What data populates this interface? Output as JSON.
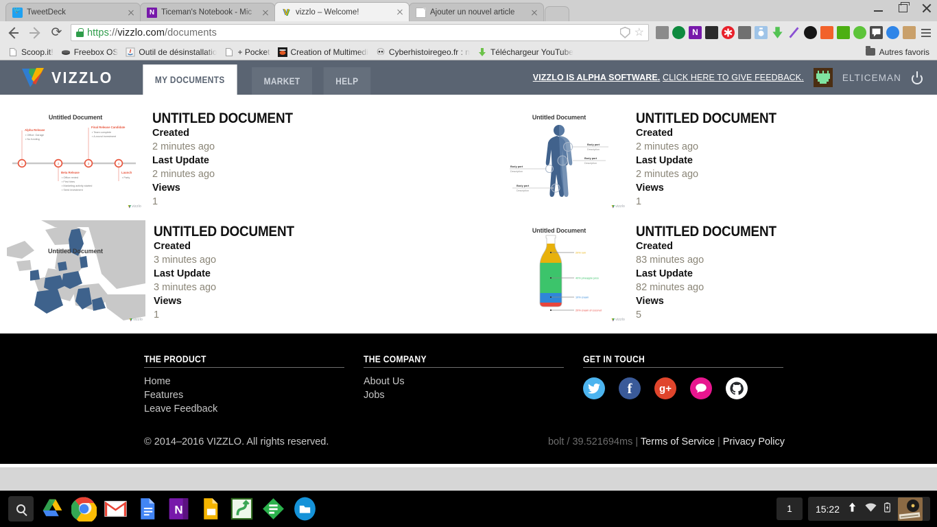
{
  "browser": {
    "tabs": [
      {
        "title": "TweetDeck",
        "favicon": "tweetdeck-icon",
        "active": false
      },
      {
        "title": "Ticeman's Notebook - Mic",
        "favicon": "onenote-icon",
        "active": false
      },
      {
        "title": "vizzlo – Welcome!",
        "favicon": "vizzlo-icon",
        "active": true
      },
      {
        "title": "Ajouter un nouvel article",
        "favicon": "page-icon",
        "active": false
      }
    ],
    "window_controls": [
      "minimize",
      "maximize",
      "close"
    ],
    "nav": {
      "back": "back-button",
      "forward": "forward-button",
      "reload": "reload-button"
    },
    "omnibox": {
      "scheme": "https",
      "separator": "://",
      "host": "vizzlo.com",
      "path": "/documents",
      "full_url": "https://vizzlo.com/documents",
      "secure_icon": "lock-icon",
      "shield_icon": "shield-icon",
      "bookmark_icon": "star-icon"
    },
    "extensions": [
      {
        "name": "extension-blocks",
        "color": "#8b8b8b"
      },
      {
        "name": "extension-green-download",
        "color": "#0e8a3e"
      },
      {
        "name": "extension-onenote",
        "color": "#7719aa"
      },
      {
        "name": "extension-film",
        "color": "#2b2b2b"
      },
      {
        "name": "extension-asterisk-red",
        "color": "#e8202a"
      },
      {
        "name": "extension-grey-app",
        "color": "#707070"
      },
      {
        "name": "extension-camera",
        "color": "#9fc4e8"
      },
      {
        "name": "extension-green-arrow",
        "color": "#53c353"
      },
      {
        "name": "extension-purple-feather",
        "color": "#8a4fd3"
      },
      {
        "name": "extension-dark-lens",
        "color": "#151515"
      },
      {
        "name": "extension-orange-book",
        "color": "#f2622a"
      },
      {
        "name": "extension-green-print",
        "color": "#4caf12"
      },
      {
        "name": "extension-green-dot",
        "color": "#5dc43a"
      },
      {
        "name": "extension-speech-bubble",
        "color": "#4a4a4a"
      },
      {
        "name": "extension-blue-fox",
        "color": "#2f85e8"
      },
      {
        "name": "extension-cat",
        "color": "#c9a06a"
      }
    ],
    "menu_icon": "chrome-menu-icon",
    "bookmarks": [
      {
        "label": "Scoop.it!",
        "icon": "page-icon"
      },
      {
        "label": "Freebox OS",
        "icon": "freebox-icon"
      },
      {
        "label": "Outil de désinstallatio",
        "icon": "java-icon"
      },
      {
        "label": "+ Pocket",
        "icon": "page-icon"
      },
      {
        "label": "Creation of Multimedi",
        "icon": "multimedia-icon"
      },
      {
        "label": "Cyberhistoiregeo.fr : n",
        "icon": "skull-icon"
      },
      {
        "label": "Téléchargeur YouTube",
        "icon": "green-download-icon"
      }
    ],
    "other_bookmarks": {
      "label": "Autres favoris",
      "icon": "folder-icon"
    }
  },
  "vizzlo": {
    "brand": "VIZZLO",
    "logo_icon": "vizzlo-v-logo",
    "nav": [
      {
        "label": "MY DOCUMENTS",
        "active": true
      },
      {
        "label": "MARKET",
        "active": false
      },
      {
        "label": "HELP",
        "active": false
      }
    ],
    "alpha_notice_bold": "VIZZLO IS ALPHA SOFTWARE.",
    "alpha_notice_link": "CLICK HERE TO GIVE FEEDBACK.",
    "user": {
      "name": "ELTICEMAN",
      "avatar_icon": "pixel-avatar-icon"
    },
    "logout_icon": "power-icon"
  },
  "documents": [
    {
      "title": "UNTITLED DOCUMENT",
      "thumb_title": "Untitled Document",
      "thumb_type": "timeline-chart",
      "labels": {
        "created": "Created",
        "last_update": "Last Update",
        "views": "Views"
      },
      "created": "2 minutes ago",
      "last_update": "2 minutes ago",
      "views": "1",
      "credit": "vizzlo"
    },
    {
      "title": "UNTITLED DOCUMENT",
      "thumb_title": "Untitled Document",
      "thumb_type": "body-diagram",
      "labels": {
        "created": "Created",
        "last_update": "Last Update",
        "views": "Views"
      },
      "created": "2 minutes ago",
      "last_update": "2 minutes ago",
      "views": "1",
      "credit": "vizzlo"
    },
    {
      "title": "UNTITLED DOCUMENT",
      "thumb_title": "Untitled Document",
      "thumb_type": "europe-map",
      "labels": {
        "created": "Created",
        "last_update": "Last Update",
        "views": "Views"
      },
      "created": "3 minutes ago",
      "last_update": "3 minutes ago",
      "views": "1",
      "credit": "vizzlo"
    },
    {
      "title": "UNTITLED DOCUMENT",
      "thumb_title": "Untitled Document",
      "thumb_type": "bottle-chart",
      "labels": {
        "created": "Created",
        "last_update": "Last Update",
        "views": "Views"
      },
      "created": "83 minutes ago",
      "last_update": "82 minutes ago",
      "views": "5",
      "credit": "vizzlo"
    }
  ],
  "thumb_content": {
    "timeline": {
      "milestones": [
        {
          "n": "1",
          "title": "Alpha Release",
          "items": [
            "Office: Garage",
            "No funding"
          ],
          "above": true
        },
        {
          "n": "2",
          "title": "Beta Release",
          "items": [
            "Office rented",
            "First hires",
            "Marketing activity started",
            "Seed investment"
          ],
          "above": false
        },
        {
          "n": "3",
          "title": "Final Release Candidate",
          "items": [
            "Team complete",
            "A-round investment"
          ],
          "above": true
        },
        {
          "n": "4",
          "title": "Launch",
          "items": [
            "Party"
          ],
          "above": false
        }
      ]
    },
    "body": {
      "callouts": [
        {
          "title": "Body part",
          "desc": "Description",
          "side": "right"
        },
        {
          "title": "Body part",
          "desc": "Description",
          "side": "right"
        },
        {
          "title": "Body part",
          "desc": "Description",
          "side": "left"
        },
        {
          "title": "Body part",
          "desc": "Description",
          "side": "left"
        }
      ]
    },
    "bottle": {
      "segments": [
        {
          "label": "20% rum",
          "color": "#e8b10b",
          "pct": 20
        },
        {
          "label": "40% pineapple juice",
          "color": "#3cc46b",
          "pct": 40
        },
        {
          "label": "10% cream",
          "color": "#2f86d8",
          "pct": 10
        },
        {
          "label": "20% cream of coconut",
          "color": "#e8453c",
          "pct": 20
        }
      ]
    }
  },
  "footer": {
    "columns": [
      {
        "heading": "THE PRODUCT",
        "links": [
          "Home",
          "Features",
          "Leave Feedback"
        ]
      },
      {
        "heading": "THE COMPANY",
        "links": [
          "About Us",
          "Jobs"
        ]
      }
    ],
    "social_heading": "GET IN TOUCH",
    "socials": [
      {
        "name": "twitter-icon",
        "glyph": "🐦",
        "color": "#4cb4ef"
      },
      {
        "name": "facebook-icon",
        "glyph": "f",
        "color": "#3a5a99"
      },
      {
        "name": "google-plus-icon",
        "glyph": "g+",
        "color": "#e0452c"
      },
      {
        "name": "chat-icon",
        "glyph": "💬",
        "color": "#e8168f"
      },
      {
        "name": "github-icon",
        "glyph": "●",
        "color": "#ffffff"
      }
    ],
    "copyright": "© 2014–2016 VIZZLO. All rights reserved.",
    "perf": "bolt / 39.521694ms",
    "sep1": "|",
    "terms": "Terms of Service",
    "sep2": "|",
    "privacy": "Privacy Policy"
  },
  "shelf": {
    "apps": [
      {
        "name": "launcher-search-icon"
      },
      {
        "name": "google-drive-icon"
      },
      {
        "name": "chrome-icon"
      },
      {
        "name": "gmail-icon"
      },
      {
        "name": "google-docs-icon"
      },
      {
        "name": "onenote-icon"
      },
      {
        "name": "google-slides-icon"
      },
      {
        "name": "green-app-icon"
      },
      {
        "name": "feedly-icon"
      },
      {
        "name": "files-icon"
      }
    ],
    "desktop_count": "1",
    "clock": "15:22",
    "tray_icons": [
      "upload-icon",
      "wifi-icon",
      "battery-icon",
      "user-avatar"
    ]
  }
}
